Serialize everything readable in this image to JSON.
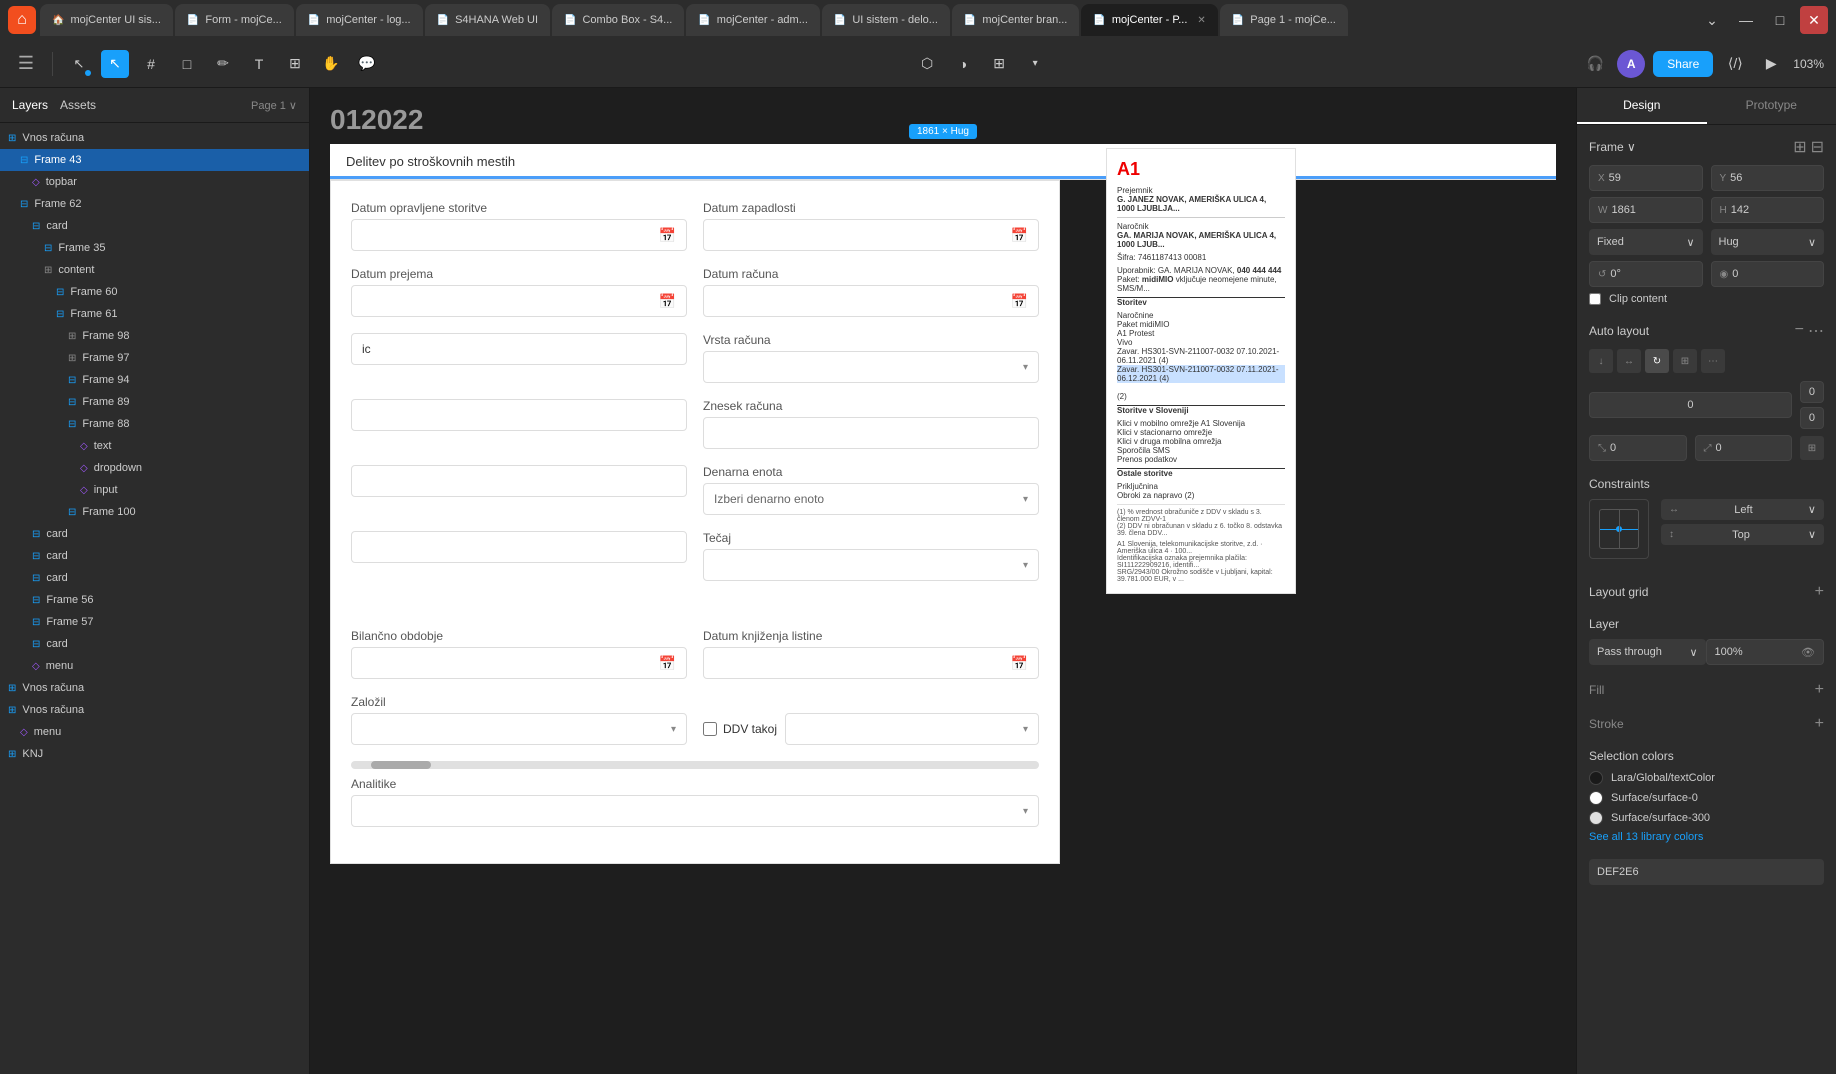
{
  "browser": {
    "tabs": [
      {
        "label": "mojCenter UI sis...",
        "active": false,
        "favicon": "🏠"
      },
      {
        "label": "Form - mojCe...",
        "active": false,
        "favicon": "📄"
      },
      {
        "label": "mojCenter - log...",
        "active": false,
        "favicon": "📄"
      },
      {
        "label": "S4HANA Web UI",
        "active": false,
        "favicon": "📄"
      },
      {
        "label": "Combo Box - S4...",
        "active": false,
        "favicon": "📄"
      },
      {
        "label": "mojCenter - adm...",
        "active": false,
        "favicon": "📄"
      },
      {
        "label": "UI sistem - delo...",
        "active": false,
        "favicon": "📄"
      },
      {
        "label": "mojCenter bran...",
        "active": false,
        "favicon": "📄"
      },
      {
        "label": "mojCenter - P...",
        "active": true,
        "favicon": "📄"
      },
      {
        "label": "Page 1 - mojCe...",
        "active": false,
        "favicon": "📄"
      }
    ]
  },
  "toolbar": {
    "zoom": "103%",
    "share_label": "Share",
    "avatar_initial": "A",
    "page_name": "Page 1"
  },
  "left_panel": {
    "tabs": [
      "Layers",
      "Assets"
    ],
    "layers": [
      {
        "label": "Vnos računa",
        "indent": 0,
        "icon": "frame",
        "type": "section"
      },
      {
        "label": "Frame 43",
        "indent": 1,
        "icon": "frame",
        "type": "frame",
        "selected": true
      },
      {
        "label": "topbar",
        "indent": 2,
        "icon": "component",
        "type": "component"
      },
      {
        "label": "Frame 62",
        "indent": 1,
        "icon": "frame",
        "type": "frame"
      },
      {
        "label": "card",
        "indent": 2,
        "icon": "frame",
        "type": "frame"
      },
      {
        "label": "Frame 35",
        "indent": 3,
        "icon": "frame",
        "type": "frame"
      },
      {
        "label": "content",
        "indent": 3,
        "icon": "content",
        "type": "content"
      },
      {
        "label": "Frame 60",
        "indent": 4,
        "icon": "frame",
        "type": "frame"
      },
      {
        "label": "Frame 61",
        "indent": 4,
        "icon": "frame",
        "type": "frame"
      },
      {
        "label": "Frame 98",
        "indent": 5,
        "icon": "content",
        "type": "content"
      },
      {
        "label": "Frame 97",
        "indent": 5,
        "icon": "content",
        "type": "content"
      },
      {
        "label": "Frame 94",
        "indent": 5,
        "icon": "frame",
        "type": "frame"
      },
      {
        "label": "Frame 89",
        "indent": 5,
        "icon": "frame",
        "type": "frame"
      },
      {
        "label": "Frame 88",
        "indent": 5,
        "icon": "frame",
        "type": "frame"
      },
      {
        "label": "text",
        "indent": 6,
        "icon": "component",
        "type": "component"
      },
      {
        "label": "dropdown",
        "indent": 6,
        "icon": "component",
        "type": "component"
      },
      {
        "label": "input",
        "indent": 6,
        "icon": "component",
        "type": "component"
      },
      {
        "label": "Frame 100",
        "indent": 5,
        "icon": "frame",
        "type": "frame"
      },
      {
        "label": "card",
        "indent": 2,
        "icon": "frame",
        "type": "frame"
      },
      {
        "label": "card",
        "indent": 2,
        "icon": "frame",
        "type": "frame"
      },
      {
        "label": "card",
        "indent": 2,
        "icon": "frame",
        "type": "frame"
      },
      {
        "label": "Frame 56",
        "indent": 2,
        "icon": "frame",
        "type": "frame"
      },
      {
        "label": "Frame 57",
        "indent": 2,
        "icon": "frame",
        "type": "frame"
      },
      {
        "label": "card",
        "indent": 2,
        "icon": "frame",
        "type": "frame"
      },
      {
        "label": "menu",
        "indent": 2,
        "icon": "component",
        "type": "component"
      },
      {
        "label": "Vnos računa",
        "indent": 0,
        "icon": "frame",
        "type": "section"
      },
      {
        "label": "Vnos računa",
        "indent": 0,
        "icon": "frame",
        "type": "section"
      },
      {
        "label": "menu",
        "indent": 1,
        "icon": "component",
        "type": "component"
      },
      {
        "label": "KNJ",
        "indent": 0,
        "icon": "frame",
        "type": "section"
      }
    ]
  },
  "canvas": {
    "page_title": "012022",
    "section_label": "Delitev po stroškovnih mestih",
    "frame_size_label": "1861 × Hug",
    "form": {
      "fields": [
        {
          "label": "Datum opravljene storitve",
          "type": "date",
          "value": ""
        },
        {
          "label": "Datum zapadlosti",
          "type": "date",
          "value": ""
        },
        {
          "label": "Datum prejema",
          "type": "date",
          "value": ""
        },
        {
          "label": "Datum računa",
          "type": "date",
          "value": ""
        },
        {
          "label": "Vrsta računa",
          "type": "select",
          "value": "",
          "placeholder": ""
        },
        {
          "label": "Znesek računa",
          "type": "input",
          "value": ""
        },
        {
          "label": "Denarna enota",
          "type": "select",
          "value": "",
          "placeholder": "Izberi denarno enoto"
        },
        {
          "label": "Tečaj",
          "type": "select",
          "value": ""
        },
        {
          "label": "Bilančno obdobje",
          "type": "input",
          "value": ""
        },
        {
          "label": "Datum knjiženja listine",
          "type": "date",
          "value": ""
        },
        {
          "label": "Založil",
          "type": "select",
          "value": ""
        },
        {
          "label": "Analitike",
          "type": "select",
          "value": ""
        },
        {
          "label": "DDV takoj",
          "type": "checkbox",
          "value": false
        }
      ]
    }
  },
  "right_panel": {
    "tabs": [
      "Design",
      "Prototype"
    ],
    "active_tab": "Design",
    "frame_section": {
      "label": "Frame",
      "x": "59",
      "y": "56",
      "w": "1861",
      "h": "142",
      "rotation": "0°",
      "radius": "0",
      "fixed_label": "Fixed",
      "hug_label": "Hug",
      "clip_content": "Clip content"
    },
    "auto_layout": {
      "label": "Auto layout"
    },
    "constraints": {
      "label": "Constraints",
      "h": "Left",
      "v": "Top"
    },
    "layout_grid": {
      "label": "Layout grid"
    },
    "layer": {
      "label": "Layer",
      "blend_mode": "Pass through",
      "opacity": "100%"
    },
    "fill": {
      "label": "Fill"
    },
    "stroke": {
      "label": "Stroke"
    },
    "selection_colors": {
      "label": "Selection colors",
      "colors": [
        {
          "name": "Lara/Global/textColor",
          "color": "#1a1a1a"
        },
        {
          "name": "Surface/surface-0",
          "color": "#ffffff"
        },
        {
          "name": "Surface/surface-300",
          "color": "#e0e0e0"
        }
      ],
      "see_all_label": "See all 13 library colors"
    },
    "hex_value": "DEF2E6"
  }
}
